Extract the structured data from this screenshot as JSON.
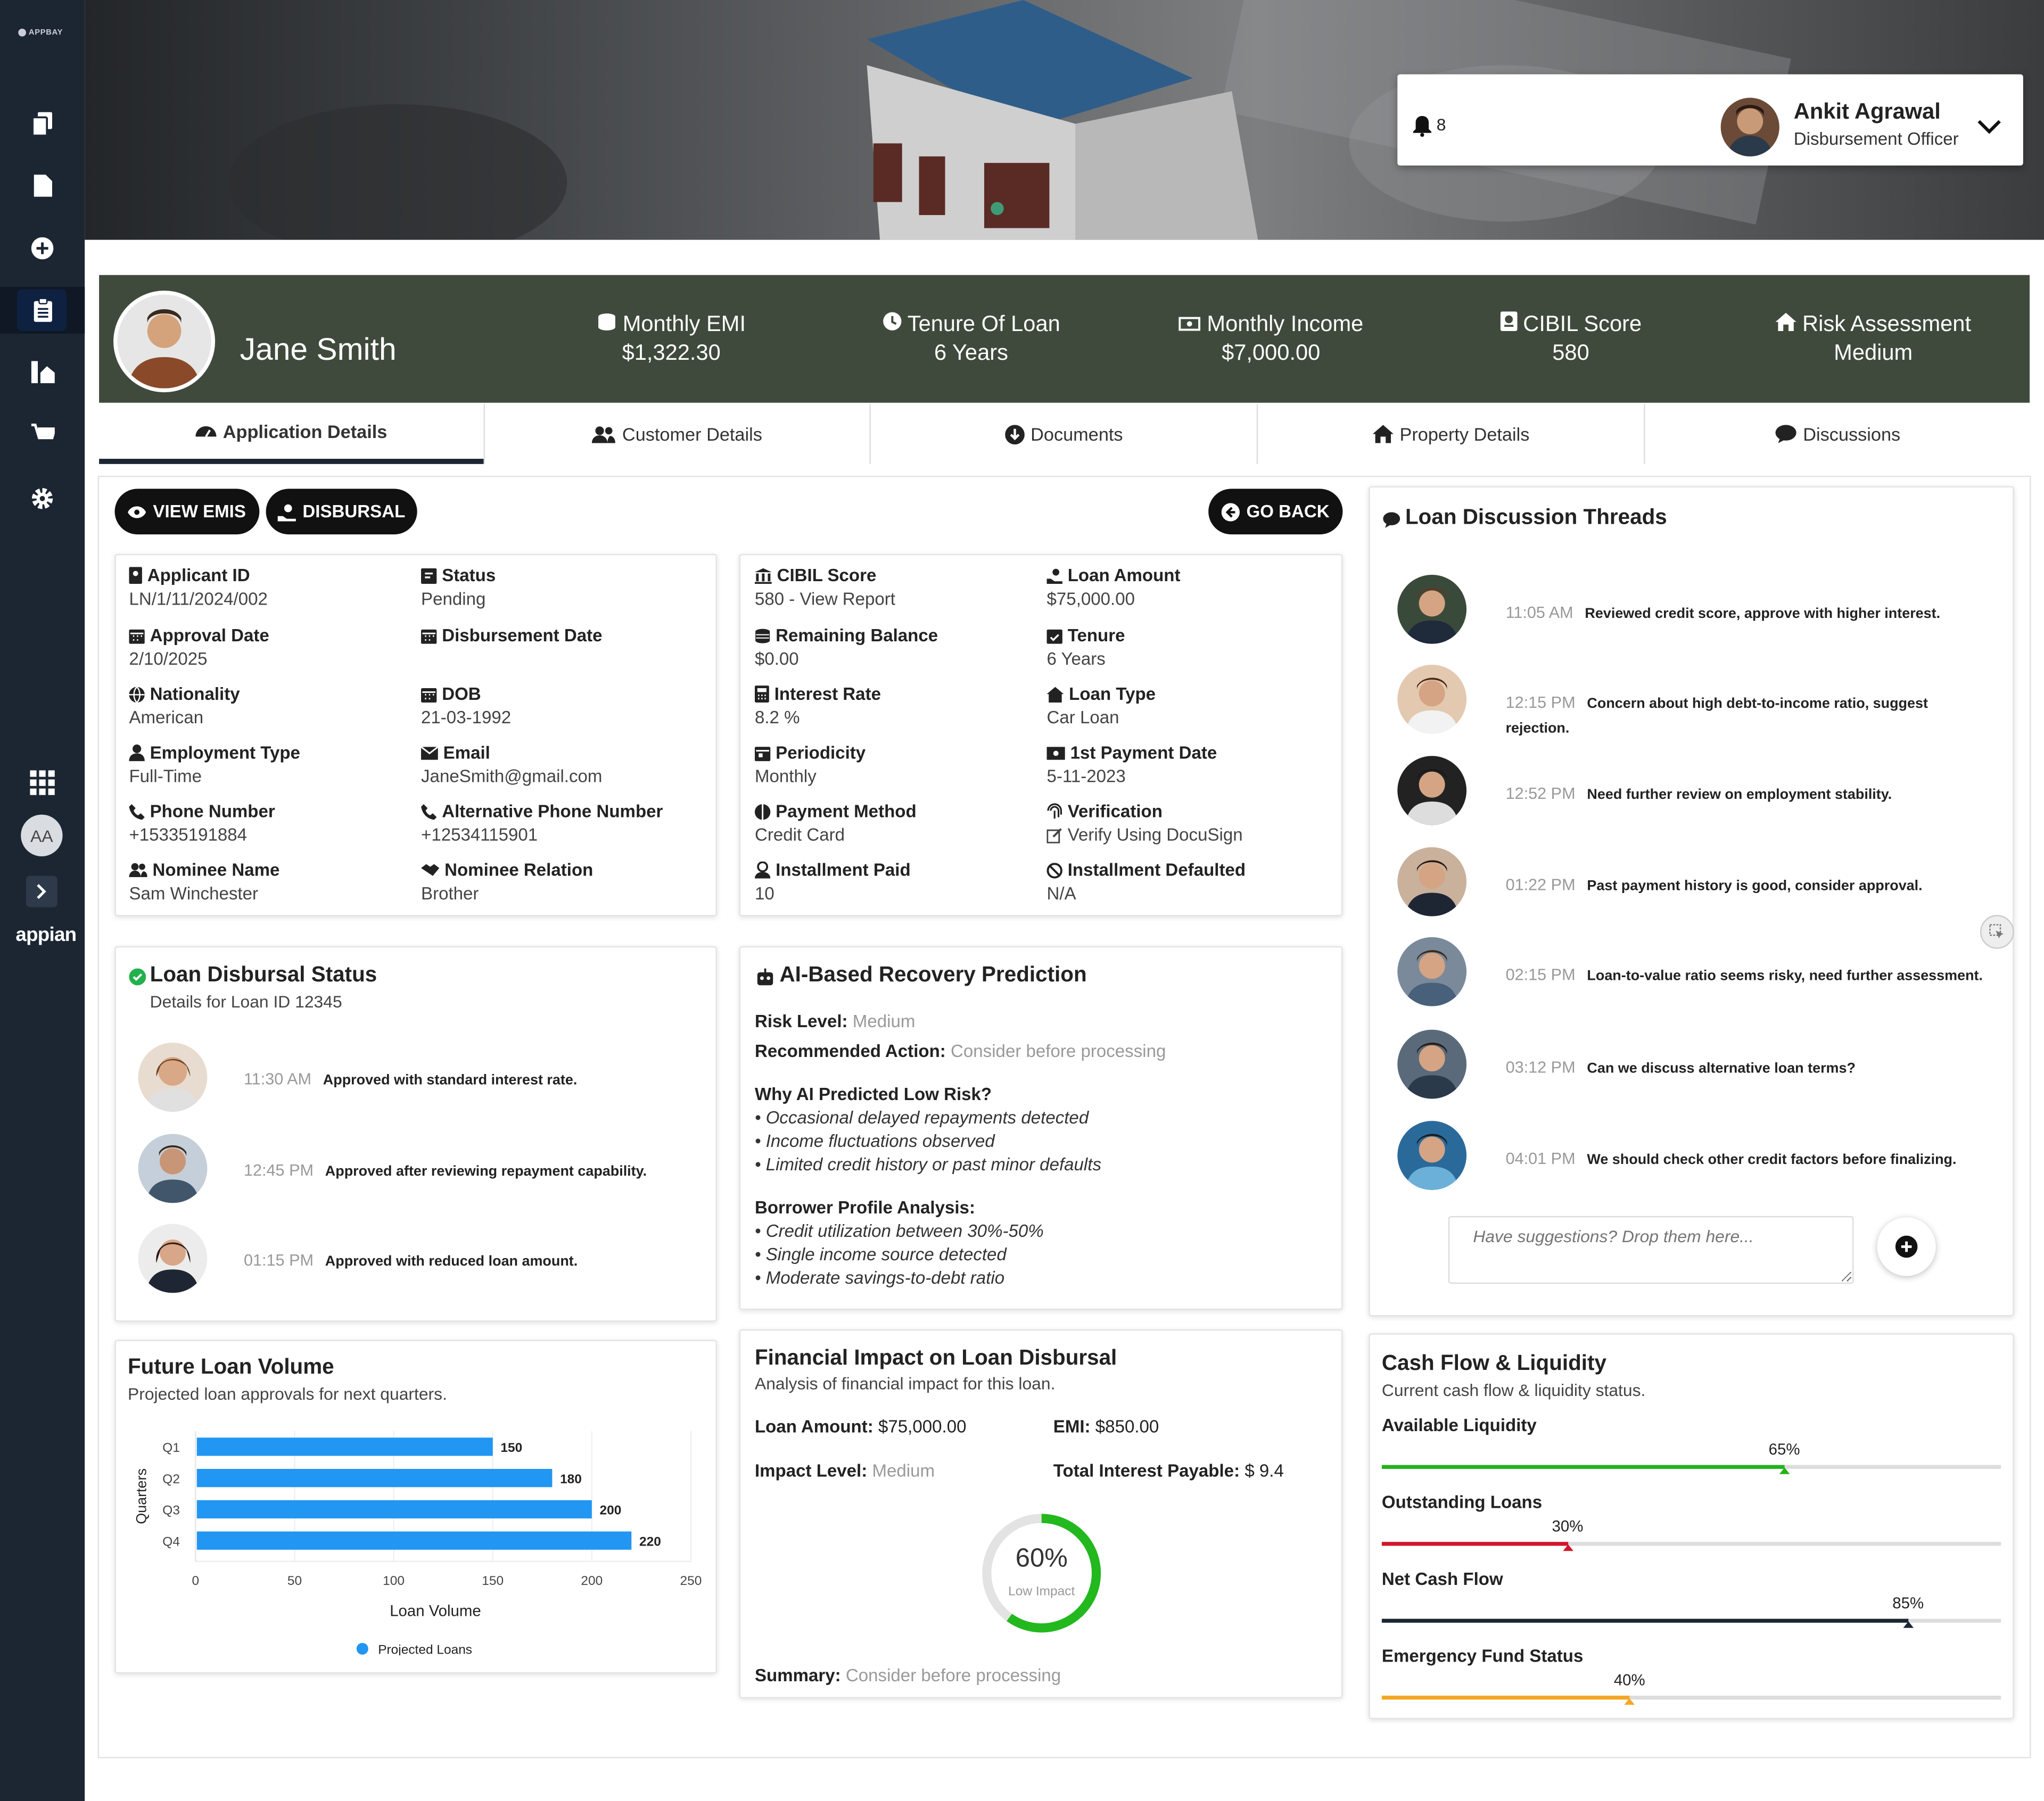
{
  "header": {
    "notifications_count": "8",
    "user_name": "Ankit Agrawal",
    "user_role": "Disbursement Officer"
  },
  "sidebar": {
    "logo_text": "APPBAY",
    "avatar_initials": "AA",
    "brand": "appian"
  },
  "profile": {
    "name": "Jane Smith",
    "kpis": [
      {
        "label": "Monthly EMI",
        "value": "$1,322.30",
        "icon": "coins-icon"
      },
      {
        "label": "Tenure Of Loan",
        "value": "6 Years",
        "icon": "clock-icon"
      },
      {
        "label": "Monthly Income",
        "value": "$7,000.00",
        "icon": "money-bill-icon"
      },
      {
        "label": "CIBIL Score",
        "value": "580",
        "icon": "report-icon"
      },
      {
        "label": "Risk Assessment",
        "value": "Medium",
        "icon": "home-icon"
      }
    ]
  },
  "tabs": [
    {
      "label": "Application Details",
      "active": true
    },
    {
      "label": "Customer Details"
    },
    {
      "label": "Documents"
    },
    {
      "label": "Property Details"
    },
    {
      "label": "Discussions"
    }
  ],
  "actions": {
    "view_emis": "VIEW EMIS",
    "disbursal": "DISBURSAL",
    "go_back": "GO BACK"
  },
  "applicant": {
    "applicant_id": {
      "label": "Applicant ID",
      "value": "LN/1/11/2024/002"
    },
    "status": {
      "label": "Status",
      "value": "Pending"
    },
    "approval_date": {
      "label": "Approval Date",
      "value": "2/10/2025"
    },
    "disbursement_date": {
      "label": "Disbursement Date",
      "value": ""
    },
    "nationality": {
      "label": "Nationality",
      "value": "American"
    },
    "dob": {
      "label": "DOB",
      "value": "21-03-1992"
    },
    "employment_type": {
      "label": "Employment Type",
      "value": "Full-Time"
    },
    "email": {
      "label": "Email",
      "value": "JaneSmith@gmail.com"
    },
    "phone": {
      "label": "Phone Number",
      "value": "+15335191884"
    },
    "alt_phone": {
      "label": "Alternative Phone Number",
      "value": "+12534115901"
    },
    "nominee_name": {
      "label": "Nominee Name",
      "value": "Sam Winchester"
    },
    "nominee_relation": {
      "label": "Nominee Relation",
      "value": "Brother"
    }
  },
  "loan": {
    "cibil": {
      "label": "CIBIL Score",
      "value": "580 - View Report"
    },
    "loan_amount": {
      "label": "Loan Amount",
      "value": "$75,000.00"
    },
    "remaining_balance": {
      "label": "Remaining Balance",
      "value": "$0.00"
    },
    "tenure": {
      "label": "Tenure",
      "value": "6 Years"
    },
    "interest_rate": {
      "label": "Interest Rate",
      "value": "8.2 %"
    },
    "loan_type": {
      "label": "Loan Type",
      "value": "Car Loan"
    },
    "periodicity": {
      "label": "Periodicity",
      "value": "Monthly"
    },
    "first_payment": {
      "label": "1st Payment Date",
      "value": "5-11-2023"
    },
    "payment_method": {
      "label": "Payment Method",
      "value": "Credit Card"
    },
    "verification": {
      "label": "Verification",
      "value": "Verify Using DocuSign"
    },
    "installment_paid": {
      "label": "Installment Paid",
      "value": "10"
    },
    "installment_defaulted": {
      "label": "Installment Defaulted",
      "value": "N/A"
    }
  },
  "disbursal_status": {
    "title": "Loan Disbursal Status",
    "subtitle": "Details for Loan ID 12345",
    "entries": [
      {
        "time": "11:30 AM",
        "text": "Approved with standard interest rate."
      },
      {
        "time": "12:45 PM",
        "text": "Approved after reviewing repayment capability."
      },
      {
        "time": "01:15 PM",
        "text": "Approved with reduced loan amount."
      }
    ]
  },
  "ai_prediction": {
    "title": "AI-Based Recovery Prediction",
    "risk_label": "Risk Level:",
    "risk_value": "Medium",
    "action_label": "Recommended Action:",
    "action_value": "Consider before processing",
    "why_title": "Why AI Predicted Low Risk?",
    "why_items": [
      "• Occasional delayed repayments detected",
      "• Income fluctuations observed",
      "• Limited credit history or past minor defaults"
    ],
    "profile_title": "Borrower Profile Analysis:",
    "profile_items": [
      "• Credit utilization between 30%-50%",
      "• Single income source detected",
      "• Moderate savings-to-debt ratio"
    ]
  },
  "discussion": {
    "title": "Loan Discussion Threads",
    "placeholder": "Have suggestions? Drop them here...",
    "threads": [
      {
        "time": "11:05 AM",
        "text": "Reviewed credit score, approve with higher interest."
      },
      {
        "time": "12:15 PM",
        "text": "Concern about high debt-to-income ratio, suggest rejection."
      },
      {
        "time": "12:52 PM",
        "text": "Need further review on employment stability."
      },
      {
        "time": "01:22 PM",
        "text": "Past payment history is good, consider approval."
      },
      {
        "time": "02:15 PM",
        "text": "Loan-to-value ratio seems risky, need further assessment."
      },
      {
        "time": "03:12 PM",
        "text": "Can we discuss alternative loan terms?"
      },
      {
        "time": "04:01 PM",
        "text": "We should check other credit factors before finalizing."
      }
    ]
  },
  "future_volume": {
    "title": "Future Loan Volume",
    "subtitle": "Projected loan approvals for next quarters."
  },
  "chart_data": {
    "type": "bar",
    "orientation": "horizontal",
    "categories": [
      "Q1",
      "Q2",
      "Q3",
      "Q4"
    ],
    "series": [
      {
        "name": "Projected Loans",
        "values": [
          150,
          180,
          200,
          220
        ],
        "color": "#2196f3"
      }
    ],
    "xlabel": "Loan Volume",
    "ylabel": "Quarters",
    "xlim": [
      0,
      250
    ],
    "xticks": [
      0,
      50,
      100,
      150,
      200,
      250
    ],
    "legend": "bottom",
    "grid": false
  },
  "financial_impact": {
    "title": "Financial Impact on Loan Disbursal",
    "subtitle": "Analysis of financial impact for this loan.",
    "loan_amount_label": "Loan Amount:",
    "loan_amount_value": "$75,000.00",
    "emi_label": "EMI:",
    "emi_value": "$850.00",
    "impact_label": "Impact Level:",
    "impact_value": "Medium",
    "interest_label": "Total Interest Payable:",
    "interest_value": "$ 9.4",
    "gauge_percent": 60,
    "gauge_text": "60%",
    "gauge_caption": "Low Impact",
    "gauge_color": "#22b81e",
    "summary_label": "Summary:",
    "summary_value": "Consider before processing"
  },
  "cash_flow": {
    "title": "Cash Flow & Liquidity",
    "subtitle": "Current cash flow & liquidity status.",
    "bars": [
      {
        "name": "Available Liquidity",
        "value": 65,
        "label": "65%",
        "color": "#23b21c"
      },
      {
        "name": "Outstanding Loans",
        "value": 30,
        "label": "30%",
        "color": "#d3162d"
      },
      {
        "name": "Net Cash Flow",
        "value": 85,
        "label": "85%",
        "color": "#1c2633"
      },
      {
        "name": "Emergency Fund Status",
        "value": 40,
        "label": "40%",
        "color": "#f5a623"
      }
    ]
  },
  "colors": {
    "sidebar": "#1c2633",
    "profile_strip": "#3f4a3c",
    "primary_button": "#111111",
    "chart_bar": "#2196f3"
  }
}
